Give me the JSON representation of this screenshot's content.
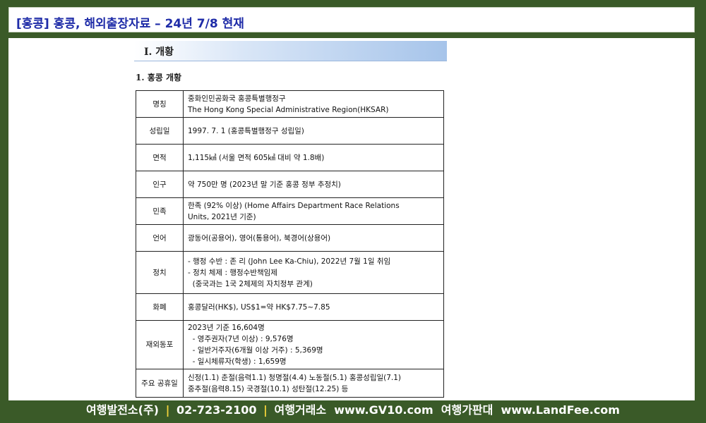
{
  "header": {
    "title": "[홍콩] 홍콩, 해외출장자료 – 24년 7/8 현재"
  },
  "doc": {
    "section_title": "Ⅰ. 개황",
    "subheading": "1. 홍콩 개황",
    "rows": [
      {
        "label": "명칭",
        "lines": [
          "중화인민공화국 홍콩특별행정구",
          "The Hong Kong Special Administrative Region(HKSAR)"
        ]
      },
      {
        "label": "성립일",
        "lines": [
          "1997. 7. 1 (홍콩특별행정구 성립일)"
        ]
      },
      {
        "label": "면적",
        "lines": [
          "1,115㎢ (서울 면적 605㎢ 대비 약 1.8배)"
        ]
      },
      {
        "label": "인구",
        "lines": [
          "약 750만 명 (2023년 말 기준 홍콩 정부 추정치)"
        ]
      },
      {
        "label": "민족",
        "lines": [
          "한족 (92% 이상) (Home Affairs Department Race Relations",
          "Units, 2021년 기준)"
        ]
      },
      {
        "label": "언어",
        "lines": [
          "광동어(공용어), 영어(통용어), 북경어(상용어)"
        ]
      },
      {
        "label": "정치",
        "lines": [
          "- 행정 수반 : 존 리 (John Lee Ka-Chiu), 2022년 7월 1일 취임",
          "- 정치 체제 : 행정수반책임제",
          "  (중국과는 1국 2체제의 자치정부 관계)"
        ]
      },
      {
        "label": "화폐",
        "lines": [
          "홍콩달러(HK$), US$1=약 HK$7.75~7.85"
        ]
      },
      {
        "label": "재외동포",
        "lines": [
          "2023년 기준 16,604명",
          "  - 영주권자(7년 이상) : 9,576명",
          "  - 일반거주자(6개월 이상 거주) : 5,369명",
          "  - 일시체류자(학생) : 1,659명"
        ]
      },
      {
        "label": "주요 공휴일",
        "lines": [
          "신정(1.1) 춘절(음력1.1) 청명절(4.4) 노동절(5.1) 홍콩성립일(7.1)",
          "중추절(음력8.15) 국경절(10.1) 성탄절(12.25) 등"
        ]
      }
    ]
  },
  "footer": {
    "company": "여행발전소(주)",
    "phone": "02-723-2100",
    "exchange_label": "여행거래소",
    "exchange_url": "www.GV10.com",
    "price_label": "여행가판대",
    "price_url": "www.LandFee.com",
    "separator": "|"
  }
}
